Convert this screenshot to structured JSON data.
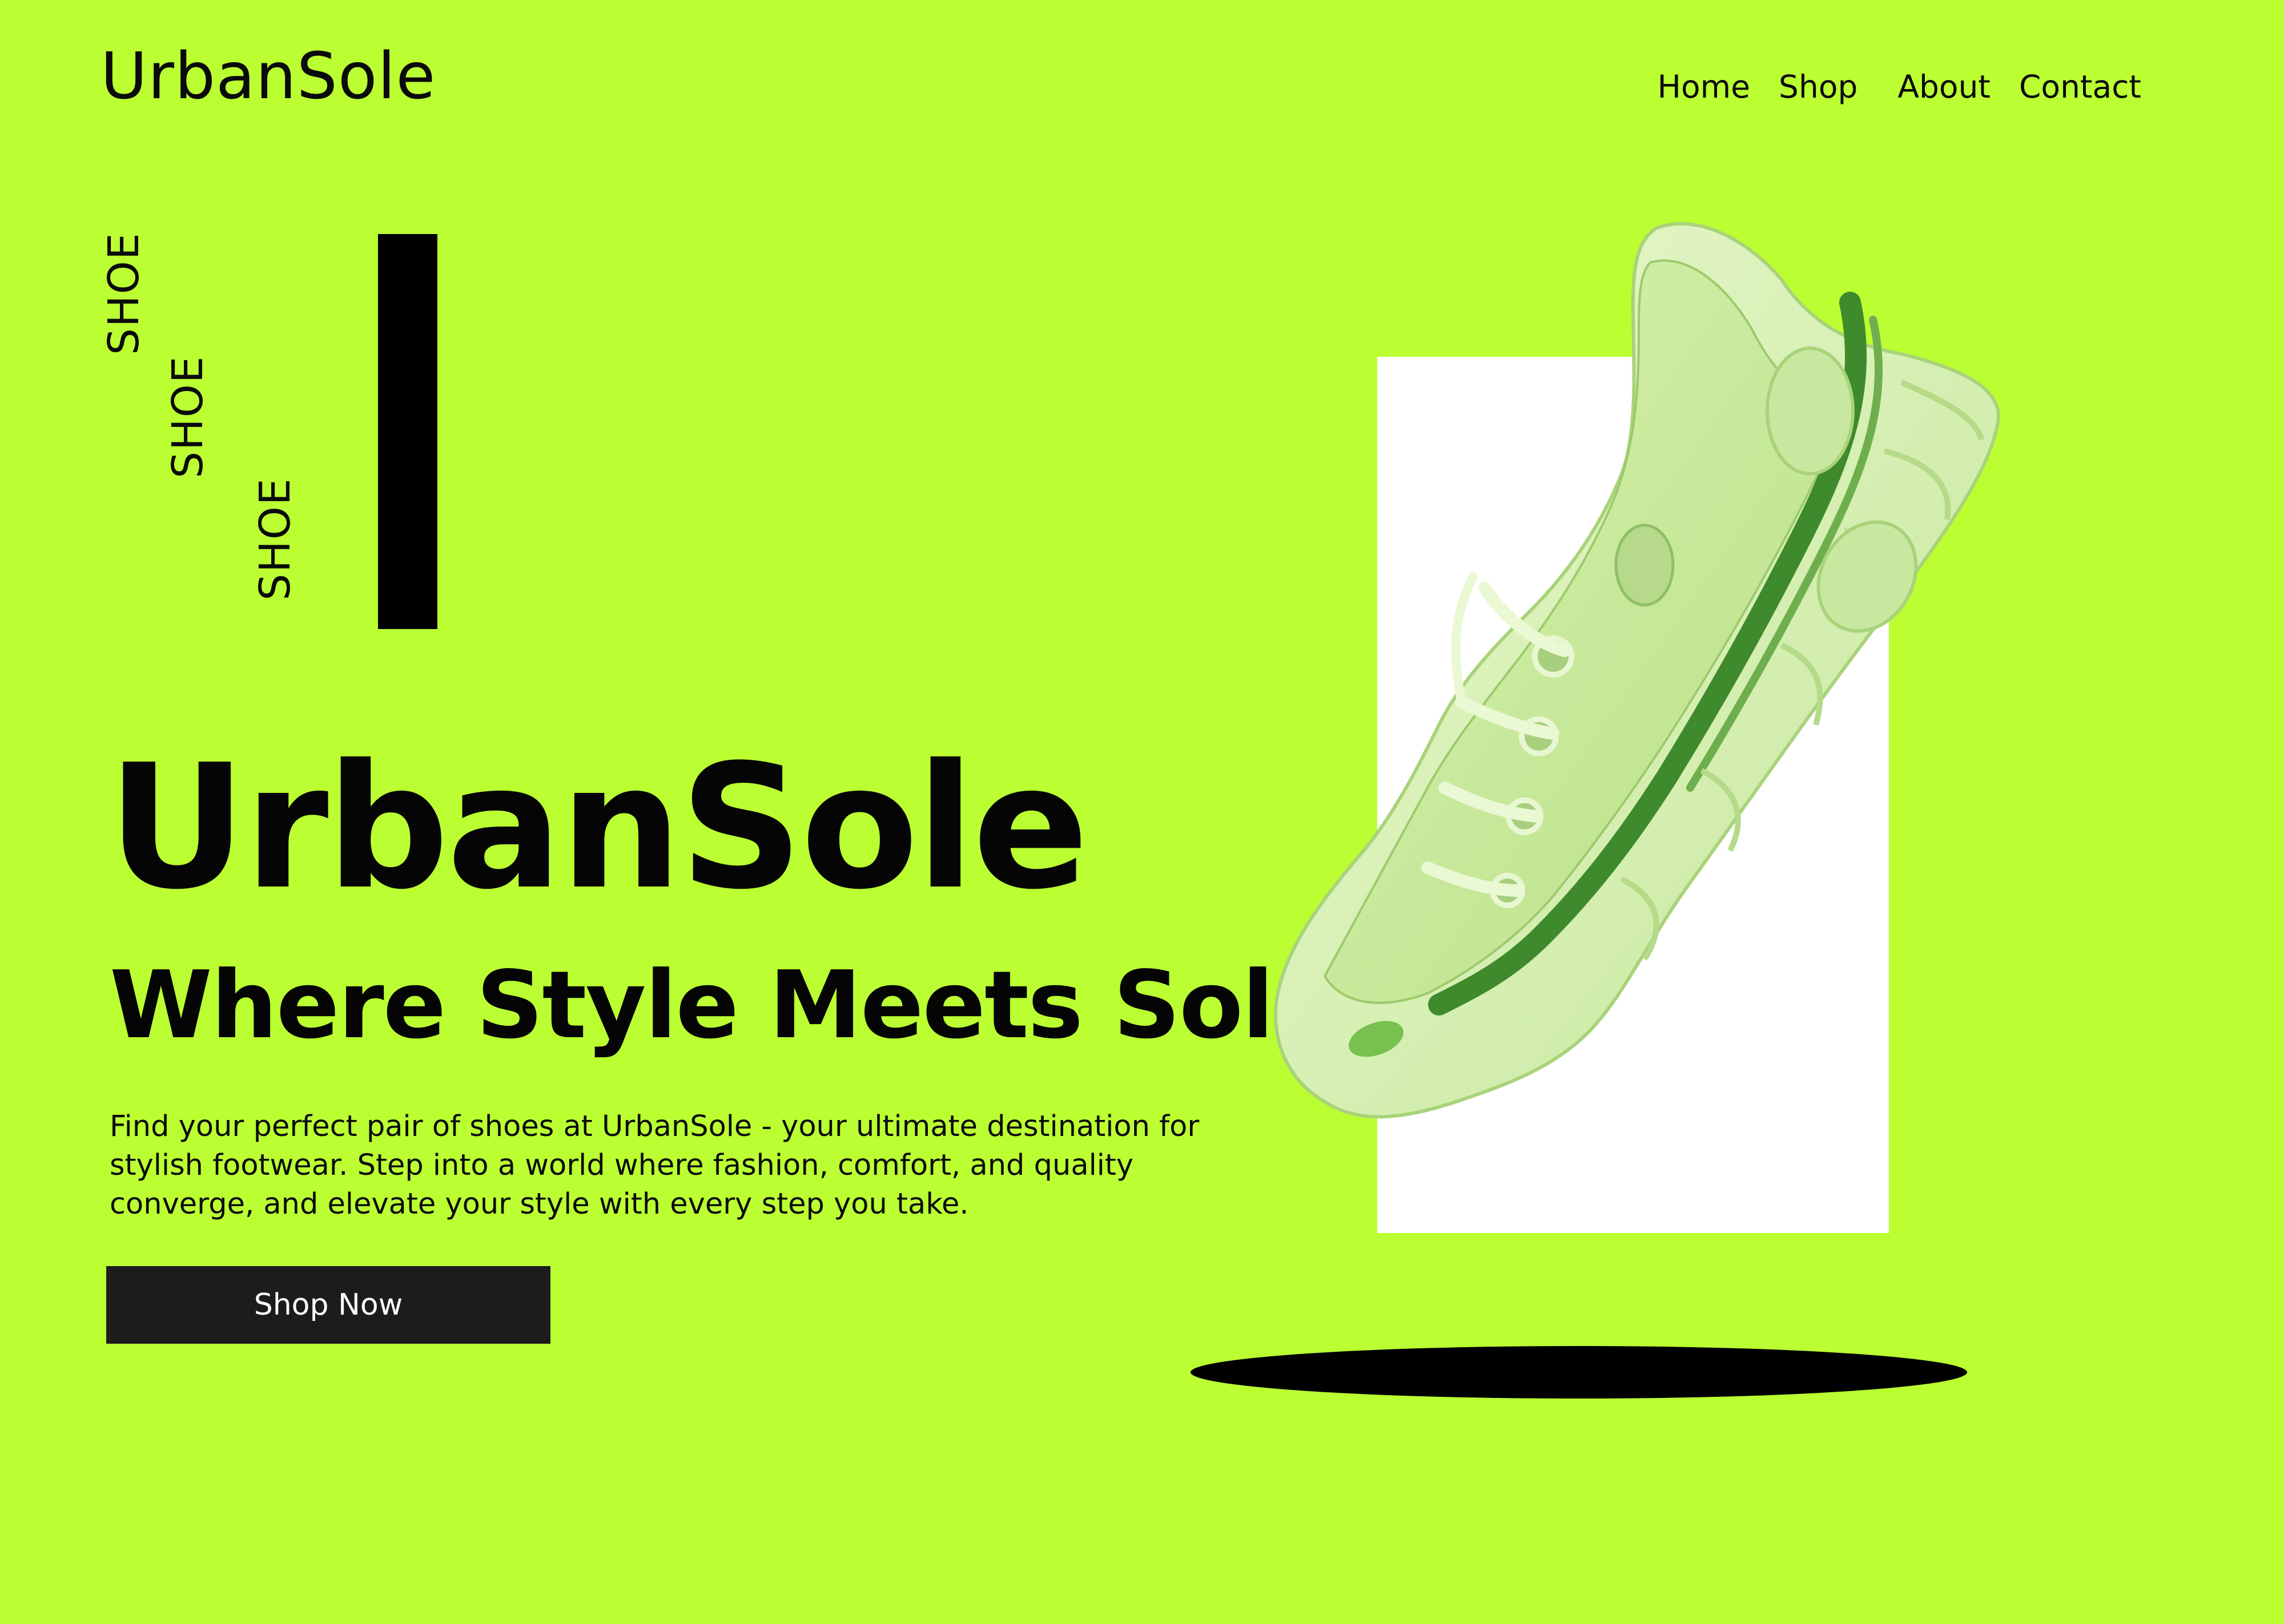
{
  "header": {
    "logo": "UrbanSole",
    "nav": [
      "Home",
      "Shop",
      "About",
      "Contact"
    ]
  },
  "side_words": [
    "SHOE",
    "SHOE",
    "SHOE"
  ],
  "hero": {
    "title": "UrbanSole",
    "subtitle": "Where Style Meets Sole",
    "description": "Find your perfect pair of shoes at UrbanSole - your ultimate destination for stylish footwear. Step into a world where fashion, comfort, and quality converge, and elevate your style with every step you take.",
    "cta_label": "Shop Now"
  },
  "colors": {
    "background": "#bbff33",
    "text": "#0a0a0a",
    "button": "#1c1c1c",
    "button_text": "#ffffff",
    "panel": "#ffffff",
    "shoe_light": "#d6f2a8",
    "shoe_dark": "#3f8a2c"
  },
  "image": {
    "subject": "green-sneaker-icon"
  }
}
